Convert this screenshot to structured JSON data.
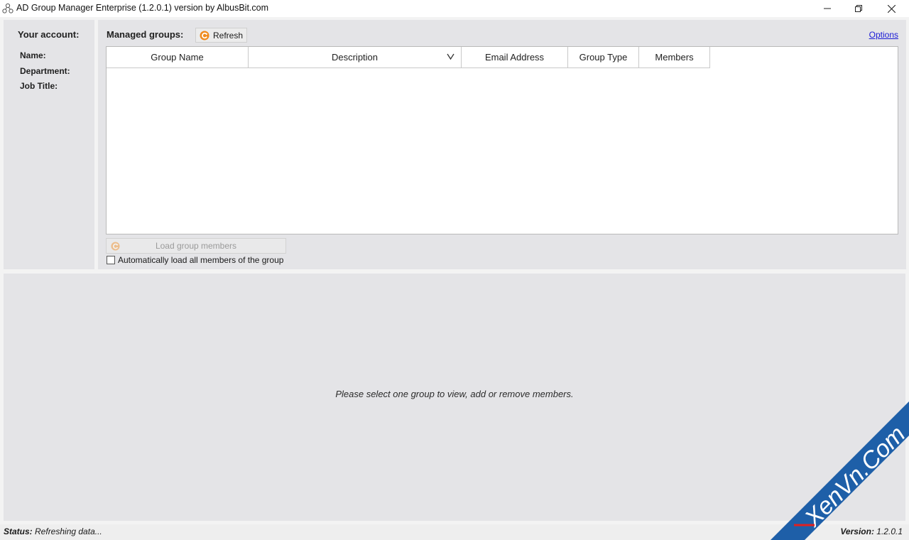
{
  "window": {
    "title": "AD Group Manager Enterprise (1.2.0.1) version by AlbusBit.com",
    "minimize_glyph": "—",
    "maximize_glyph": "❐",
    "close_glyph": "✕"
  },
  "account": {
    "title": "Your account:",
    "fields": [
      "Name:",
      "Department:",
      "Job Title:"
    ]
  },
  "groups": {
    "title": "Managed groups:",
    "refresh_label": "Refresh",
    "options_label": "Options",
    "columns": [
      "Group Name",
      "Description",
      "Email Address",
      "Group Type",
      "Members"
    ],
    "load_members_label": "Load group members",
    "auto_load_label": "Automatically load all members of the group",
    "auto_load_checked": false
  },
  "members": {
    "message": "Please select one group to view, add or remove members."
  },
  "status": {
    "label": "Status:",
    "value": "Refreshing data...",
    "version_label": "Version:",
    "version_value": "1.2.0.1"
  },
  "watermark": {
    "text": "XenVn.Com",
    "color": "#1e5fa8"
  },
  "colors": {
    "panel_bg": "#e4e4e7",
    "refresh_accent": "#f08a1c",
    "link": "#1a1ad6"
  },
  "icons": {
    "app": "network-nodes-icon",
    "refresh": "refresh-icon",
    "sort": "chevron-down-icon"
  }
}
